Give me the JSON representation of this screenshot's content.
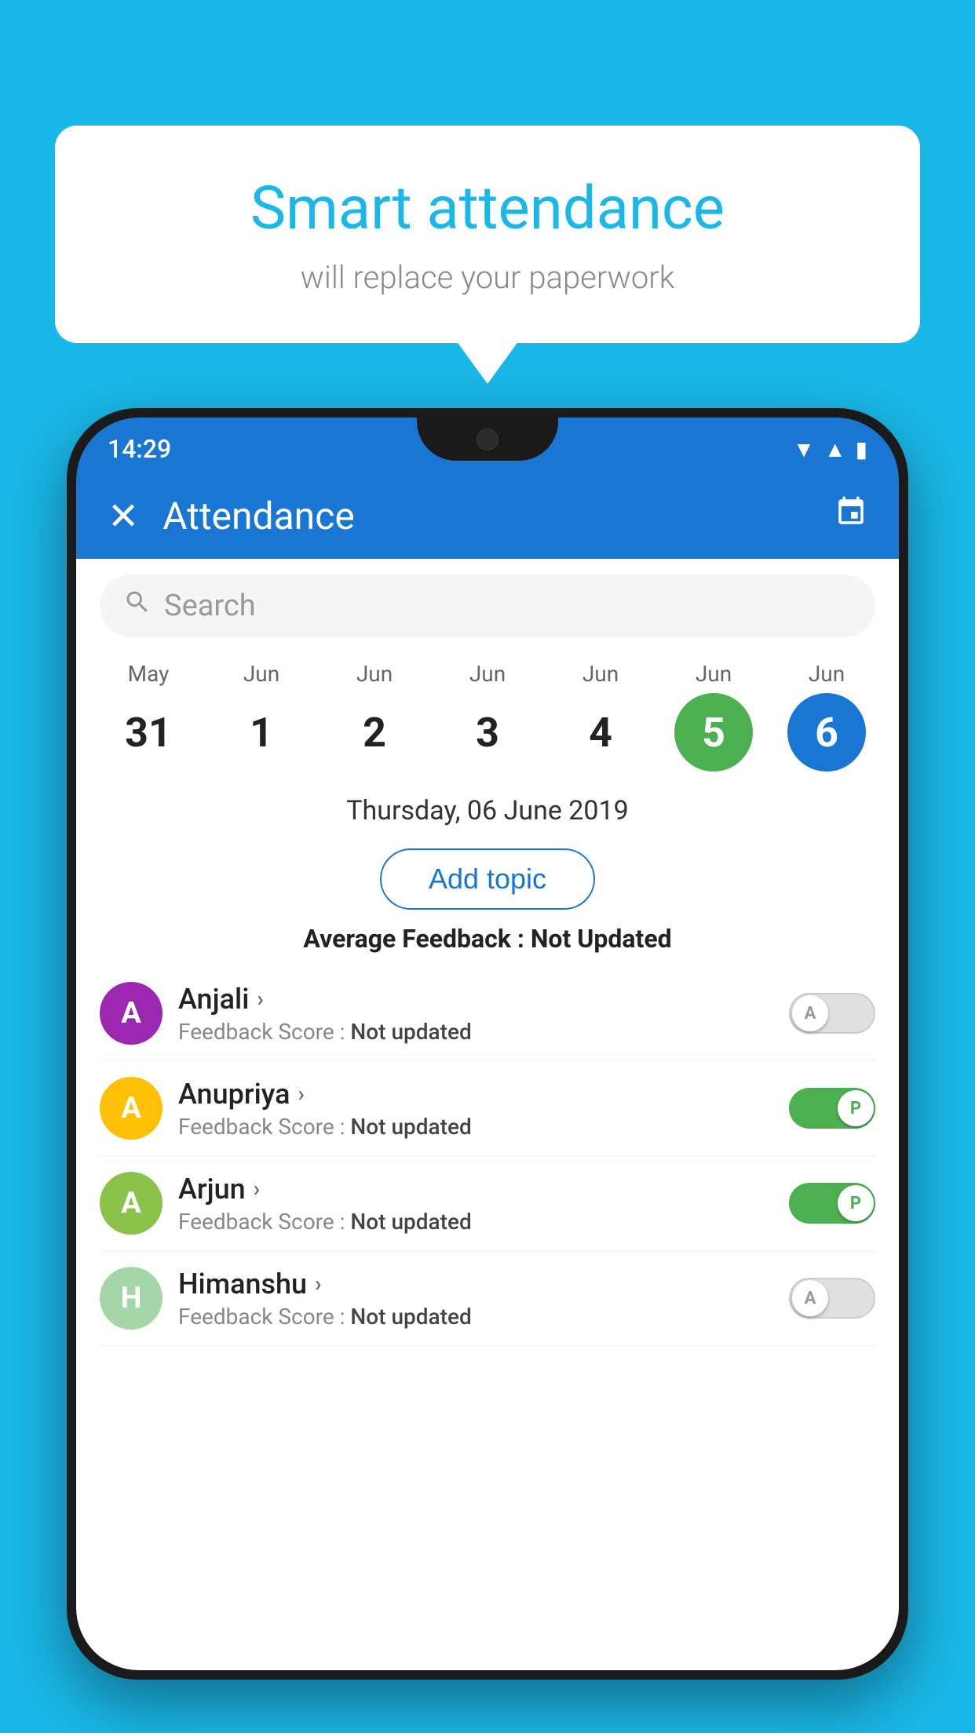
{
  "background_color": "#1ab8e8",
  "speech_bubble": {
    "title": "Smart attendance",
    "subtitle": "will replace your paperwork"
  },
  "status_bar": {
    "time": "14:29",
    "wifi": "▼",
    "signal": "▲",
    "battery": "▮"
  },
  "app_bar": {
    "title": "Attendance",
    "close_label": "✕",
    "calendar_label": "📅"
  },
  "search": {
    "placeholder": "Search"
  },
  "calendar": {
    "days": [
      {
        "month": "May",
        "date": "31",
        "state": "normal"
      },
      {
        "month": "Jun",
        "date": "1",
        "state": "normal"
      },
      {
        "month": "Jun",
        "date": "2",
        "state": "normal"
      },
      {
        "month": "Jun",
        "date": "3",
        "state": "normal"
      },
      {
        "month": "Jun",
        "date": "4",
        "state": "normal"
      },
      {
        "month": "Jun",
        "date": "5",
        "state": "today"
      },
      {
        "month": "Jun",
        "date": "6",
        "state": "selected"
      }
    ]
  },
  "selected_date": "Thursday, 06 June 2019",
  "add_topic_label": "Add topic",
  "avg_feedback_label": "Average Feedback : ",
  "avg_feedback_value": "Not Updated",
  "students": [
    {
      "name": "Anjali",
      "avatar_letter": "A",
      "avatar_color": "#9c27b0",
      "feedback_label": "Feedback Score : ",
      "feedback_value": "Not updated",
      "attendance": "absent",
      "toggle_letter": "A"
    },
    {
      "name": "Anupriya",
      "avatar_letter": "A",
      "avatar_color": "#ffc107",
      "feedback_label": "Feedback Score : ",
      "feedback_value": "Not updated",
      "attendance": "present",
      "toggle_letter": "P"
    },
    {
      "name": "Arjun",
      "avatar_letter": "A",
      "avatar_color": "#8bc34a",
      "feedback_label": "Feedback Score : ",
      "feedback_value": "Not updated",
      "attendance": "present",
      "toggle_letter": "P"
    },
    {
      "name": "Himanshu",
      "avatar_letter": "H",
      "avatar_color": "#a5d6a7",
      "feedback_label": "Feedback Score : ",
      "feedback_value": "Not updated",
      "attendance": "absent",
      "toggle_letter": "A"
    }
  ]
}
